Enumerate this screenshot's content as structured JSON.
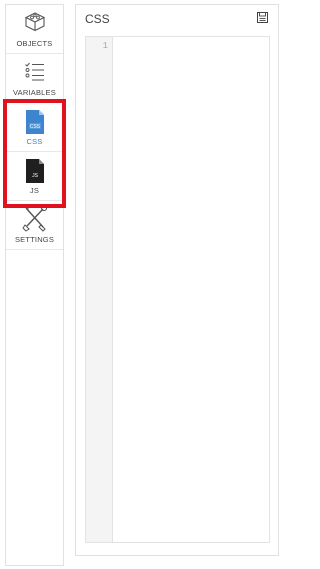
{
  "sidebar": {
    "items": [
      {
        "label": "OBJECTS",
        "icon": "cube-icon"
      },
      {
        "label": "VARIABLES",
        "icon": "checklist-icon"
      },
      {
        "label": "CSS",
        "icon": "css-file-icon",
        "active": true
      },
      {
        "label": "JS",
        "icon": "js-file-icon"
      },
      {
        "label": "SETTINGS",
        "icon": "tools-icon"
      }
    ]
  },
  "panel": {
    "title": "CSS",
    "action_icon": "save-icon",
    "editor": {
      "line_numbers": [
        "1"
      ],
      "content": ""
    }
  },
  "colors": {
    "accent": "#3d7dc7",
    "highlight": "#e0121f",
    "border": "#e1e1e1",
    "gutter": "#f4f4f4"
  }
}
